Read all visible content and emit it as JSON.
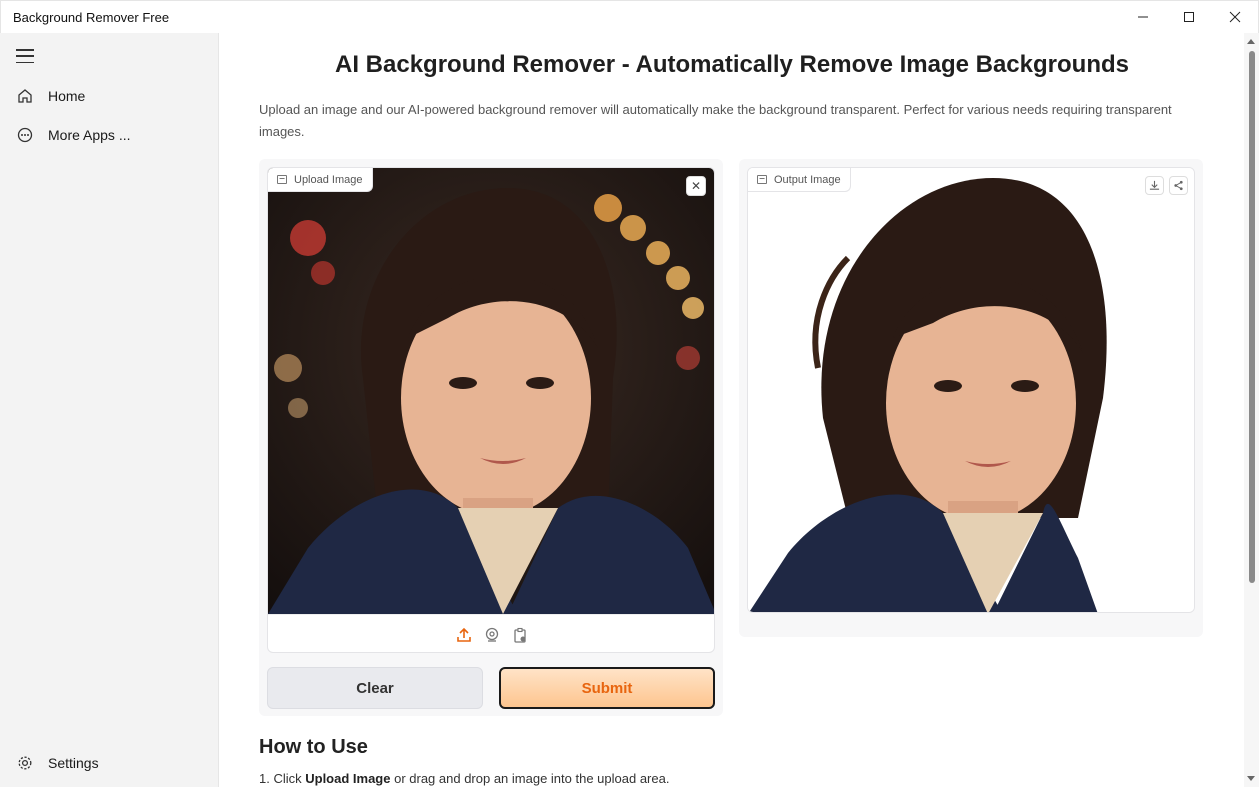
{
  "window": {
    "title": "Background Remover Free",
    "controls": [
      "minimize",
      "maximize",
      "close"
    ]
  },
  "sidebar": {
    "items": [
      {
        "label": "Home",
        "icon": "home-icon"
      },
      {
        "label": "More Apps ...",
        "icon": "more-apps-icon"
      }
    ],
    "footer": {
      "label": "Settings",
      "icon": "gear-icon"
    }
  },
  "main": {
    "title": "AI Background Remover - Automatically Remove Image Backgrounds",
    "description": "Upload an image and our AI-powered background remover will automatically make the background transparent. Perfect for various needs requiring transparent images.",
    "upload": {
      "label": "Upload Image"
    },
    "output": {
      "label": "Output Image"
    },
    "buttons": {
      "clear": "Clear",
      "submit": "Submit"
    },
    "how_to": {
      "title": "How to Use",
      "step1_prefix": "1. Click ",
      "step1_bold": "Upload Image",
      "step1_suffix": " or drag and drop an image into the upload area."
    }
  },
  "colors": {
    "accent_orange": "#e8650f",
    "submit_gradient_top": "#ffe3c7",
    "submit_gradient_bottom": "#fdc58f"
  }
}
